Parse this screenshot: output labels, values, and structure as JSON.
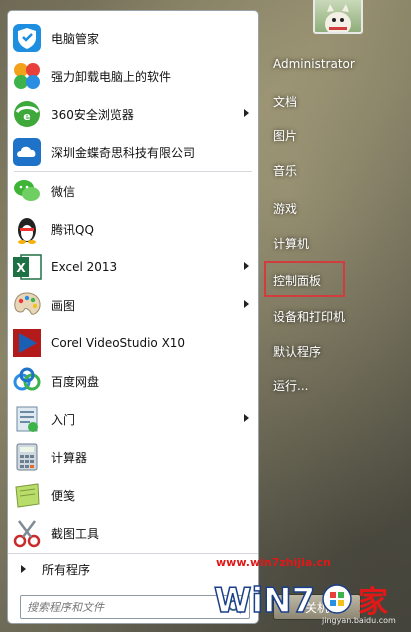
{
  "programs": [
    {
      "label": "电脑管家",
      "icon": "shield-icon",
      "has_submenu": false
    },
    {
      "label": "强力卸载电脑上的软件",
      "icon": "pinwheel-icon",
      "has_submenu": false
    },
    {
      "label": "360安全浏览器",
      "icon": "browser-360-icon",
      "has_submenu": true
    },
    {
      "label": "深圳金蝶奇思科技有限公司",
      "icon": "cloud-app-icon",
      "has_submenu": false
    },
    {
      "label": "微信",
      "icon": "wechat-icon",
      "has_submenu": false
    },
    {
      "label": "腾讯QQ",
      "icon": "qq-penguin-icon",
      "has_submenu": false
    },
    {
      "label": "Excel 2013",
      "icon": "excel-icon",
      "has_submenu": true
    },
    {
      "label": "画图",
      "icon": "paint-palette-icon",
      "has_submenu": true
    },
    {
      "label": "Corel VideoStudio X10",
      "icon": "corel-play-icon",
      "has_submenu": false
    },
    {
      "label": "百度网盘",
      "icon": "baidu-netdisk-icon",
      "has_submenu": false
    },
    {
      "label": "入门",
      "icon": "getting-started-icon",
      "has_submenu": true
    },
    {
      "label": "计算器",
      "icon": "calculator-icon",
      "has_submenu": false
    },
    {
      "label": "便笺",
      "icon": "sticky-note-icon",
      "has_submenu": false
    },
    {
      "label": "截图工具",
      "icon": "snipping-scissors-icon",
      "has_submenu": false
    }
  ],
  "all_programs_label": "所有程序",
  "search": {
    "placeholder": "搜索程序和文件"
  },
  "right_links": [
    {
      "label": "Administrator"
    },
    {
      "label": "文档"
    },
    {
      "label": "图片"
    },
    {
      "label": "音乐"
    },
    {
      "label": "游戏"
    },
    {
      "label": "计算机"
    },
    {
      "label": "控制面板"
    },
    {
      "label": "设备和打印机"
    },
    {
      "label": "默认程序"
    },
    {
      "label": "运行..."
    }
  ],
  "shutdown_label": "关机",
  "watermark": {
    "url": "www.win7zhijia.cn",
    "sub": "jingyan.baidu.com"
  },
  "colors": {
    "highlight_border": "#d23c3c",
    "watermark": "#e01818"
  }
}
